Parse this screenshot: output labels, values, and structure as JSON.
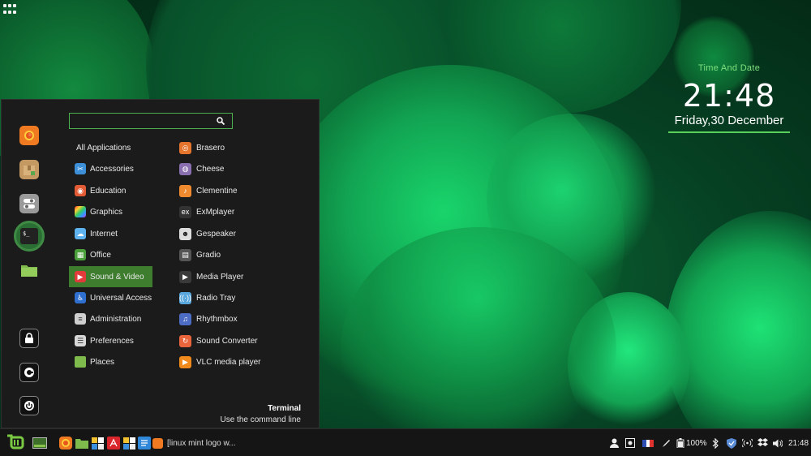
{
  "colors": {
    "accent": "#4caf50",
    "selected_category": "#3d7d2d",
    "clock_title": "#7fe07f",
    "menu_bg": "#1b1b1b",
    "panel_bg": "#151515"
  },
  "desktop": {
    "apps_grid_icon": "grid-icon"
  },
  "clock": {
    "title": "Time And Date",
    "time": "21:48",
    "date": "Friday,30 December"
  },
  "menu": {
    "search": {
      "placeholder": "",
      "value": "",
      "icon": "search-icon"
    },
    "favorites": [
      {
        "name": "firefox",
        "icon": "firefox-icon"
      },
      {
        "name": "software-manager",
        "icon": "package-icon"
      },
      {
        "name": "settings",
        "icon": "toggle-icon"
      },
      {
        "name": "terminal",
        "icon": "terminal-icon"
      },
      {
        "name": "files",
        "icon": "folder-icon"
      },
      {
        "name": "lock-screen",
        "icon": "lock-icon"
      },
      {
        "name": "logout",
        "icon": "logout-icon"
      },
      {
        "name": "quit",
        "icon": "power-icon"
      }
    ],
    "categories": [
      {
        "label": "All Applications",
        "icon": ""
      },
      {
        "label": "Accessories",
        "icon": "accessories-icon"
      },
      {
        "label": "Education",
        "icon": "education-icon"
      },
      {
        "label": "Graphics",
        "icon": "graphics-icon"
      },
      {
        "label": "Internet",
        "icon": "internet-icon"
      },
      {
        "label": "Office",
        "icon": "office-icon"
      },
      {
        "label": "Sound & Video",
        "icon": "sound-video-icon",
        "selected": true
      },
      {
        "label": "Universal Access",
        "icon": "universal-access-icon"
      },
      {
        "label": "Administration",
        "icon": "administration-icon"
      },
      {
        "label": "Preferences",
        "icon": "preferences-icon"
      },
      {
        "label": "Places",
        "icon": "places-icon"
      }
    ],
    "apps": [
      {
        "label": "Brasero",
        "icon": "brasero-icon"
      },
      {
        "label": "Cheese",
        "icon": "cheese-icon"
      },
      {
        "label": "Clementine",
        "icon": "clementine-icon"
      },
      {
        "label": "ExMplayer",
        "icon": "exmplayer-icon"
      },
      {
        "label": "Gespeaker",
        "icon": "gespeaker-icon"
      },
      {
        "label": "Gradio",
        "icon": "gradio-icon"
      },
      {
        "label": "Media Player",
        "icon": "media-player-icon"
      },
      {
        "label": "Radio Tray",
        "icon": "radio-tray-icon"
      },
      {
        "label": "Rhythmbox",
        "icon": "rhythmbox-icon"
      },
      {
        "label": "Sound Converter",
        "icon": "sound-converter-icon"
      },
      {
        "label": "VLC media player",
        "icon": "vlc-icon"
      }
    ],
    "info": {
      "name": "Terminal",
      "description": "Use the command line"
    }
  },
  "panel": {
    "menu_button_icon": "linux-mint-logo-icon",
    "launchers": [
      {
        "name": "show-desktop",
        "icon": "show-desktop-icon"
      },
      {
        "name": "firefox",
        "icon": "firefox-icon"
      },
      {
        "name": "files",
        "icon": "folder-icon"
      },
      {
        "name": "windows-app",
        "icon": "windows-icon"
      },
      {
        "name": "pdf-app",
        "icon": "pdf-icon"
      },
      {
        "name": "windows-app-2",
        "icon": "windows-icon"
      },
      {
        "name": "text-editor",
        "icon": "text-editor-icon"
      }
    ],
    "window": {
      "title": "[linux mint logo w...",
      "icon": "firefox-icon"
    },
    "tray": {
      "battery_percent": "100%",
      "time": "21:48",
      "icons": [
        "user-icon",
        "screenshot-icon",
        "flag-fr-icon",
        "pen-icon",
        "battery-icon",
        "bluetooth-icon",
        "shield-icon",
        "wifi-icon",
        "dropbox-icon",
        "volume-icon"
      ]
    }
  }
}
